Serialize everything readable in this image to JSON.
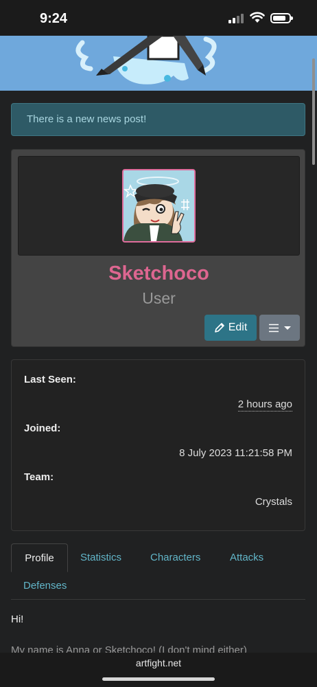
{
  "status": {
    "time": "9:24"
  },
  "alert": {
    "text": "There is a new news post!"
  },
  "profile": {
    "username": "Sketchoco",
    "role": "User",
    "edit_label": "Edit"
  },
  "info": {
    "last_seen_label": "Last Seen:",
    "last_seen_value": "2 hours ago",
    "joined_label": "Joined:",
    "joined_value": "8 July 2023 11:21:58 PM",
    "team_label": "Team:",
    "team_value": "Crystals"
  },
  "tabs": [
    "Profile",
    "Statistics",
    "Characters",
    "Attacks",
    "Defenses"
  ],
  "content": {
    "greeting": "Hi!",
    "partial_line": "My name is Anna or Sketchoco! (I don't mind either)"
  },
  "browser": {
    "url": "artfight.net"
  },
  "colors": {
    "accent": "#dd6690",
    "link": "#62b6c9",
    "banner": "#6fa8dc",
    "alert_bg": "#2e5a66"
  }
}
